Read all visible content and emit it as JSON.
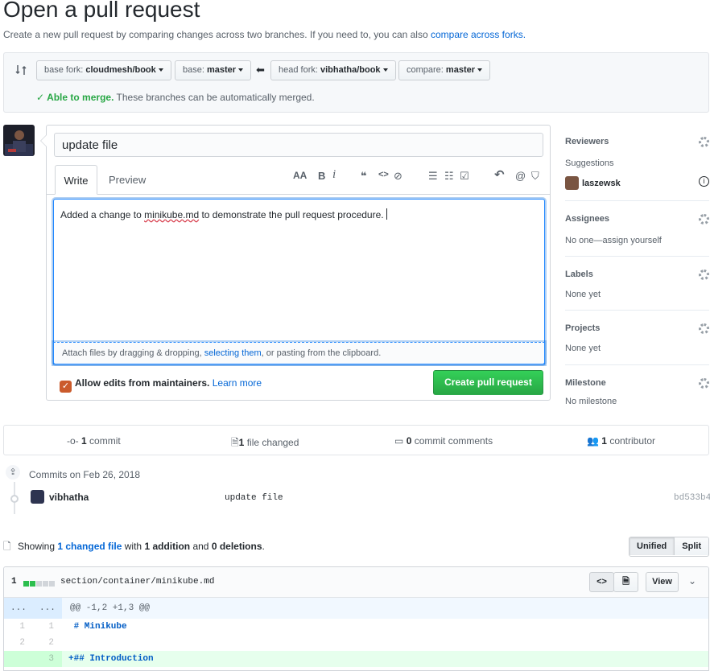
{
  "header": {
    "title": "Open a pull request",
    "subtitle": "Create a new pull request by comparing changes across two branches. If you need to, you can also",
    "subtitle_link": "compare across forks."
  },
  "range": {
    "base_fork_label": "base fork:",
    "base_fork_value": "cloudmesh/book",
    "base_label": "base:",
    "base_value": "master",
    "head_fork_label": "head fork:",
    "head_fork_value": "vibhatha/book",
    "compare_label": "compare:",
    "compare_value": "master",
    "merge_status": "Able to merge.",
    "merge_text": "These branches can be automatically merged."
  },
  "form": {
    "title_value": "update file",
    "tab_write": "Write",
    "tab_preview": "Preview",
    "toolbar": {
      "header": "AA",
      "bold": "B",
      "italic": "i",
      "quote": "❝",
      "code": "<>",
      "link": "⊘",
      "ul": "☰",
      "ol": "☷",
      "task": "☑",
      "reply": "↶",
      "mention": "@",
      "bookmark": "⛉"
    },
    "body_pre": "Added a change to ",
    "body_spell": "minikube.md",
    "body_post": " to demonstrate the pull request procedure.",
    "attach_pre": "Attach files by dragging & dropping, ",
    "attach_link": "selecting them",
    "attach_post": ", or pasting from the clipboard.",
    "allow_label": "Allow edits from maintainers.",
    "learn_more": "Learn more",
    "submit": "Create pull request"
  },
  "sidebar": {
    "reviewers": {
      "heading": "Reviewers",
      "suggestions": "Suggestions",
      "user": "laszewsk"
    },
    "assignees": {
      "heading": "Assignees",
      "text": "No one—assign yourself"
    },
    "labels": {
      "heading": "Labels",
      "text": "None yet"
    },
    "projects": {
      "heading": "Projects",
      "text": "None yet"
    },
    "milestone": {
      "heading": "Milestone",
      "text": "No milestone"
    }
  },
  "stats": {
    "commits_n": "1",
    "commits_label": "commit",
    "files_n": "1",
    "files_label": "file changed",
    "comments_n": "0",
    "comments_label": "commit comments",
    "contributors_n": "1",
    "contributors_label": "contributor"
  },
  "commits": {
    "heading": "Commits on Feb 26, 2018",
    "author": "vibhatha",
    "message": "update file",
    "sha": "bd533b4"
  },
  "diffsummary": {
    "showing": "Showing",
    "changed_link": "1 changed file",
    "with": "with",
    "additions": "1 addition",
    "and": "and",
    "deletions": "0 deletions",
    "period": ".",
    "unified": "Unified",
    "split": "Split"
  },
  "file": {
    "count": "1",
    "path": "section/container/minikube.md",
    "view": "View",
    "hunk": "@@ -1,2 +1,3 @@",
    "hunk_dots": "...",
    "lines": [
      {
        "old": "1",
        "new": "1",
        "code": " # Minikube"
      },
      {
        "old": "2",
        "new": "2",
        "code": ""
      },
      {
        "old": "",
        "new": "3",
        "code": "+## Introduction"
      }
    ]
  },
  "colors": {
    "link": "#0366d6",
    "green": "#28a745",
    "checkbox": "#cb5b2c"
  }
}
